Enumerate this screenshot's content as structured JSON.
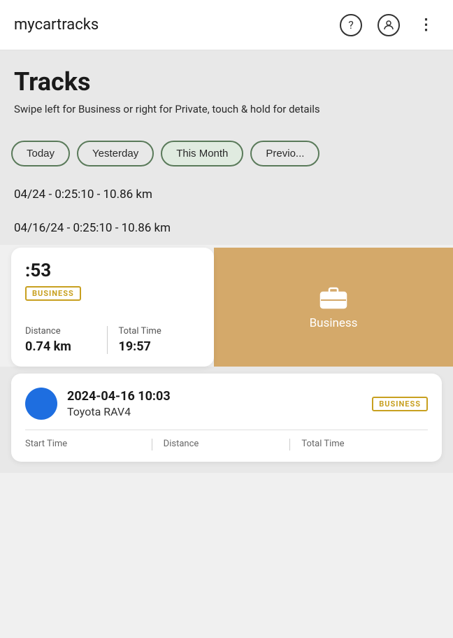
{
  "app": {
    "title": "mycartracks"
  },
  "header": {
    "tracks_title": "Tracks",
    "tracks_subtitle": "Swipe left for Business or right for Private, touch & hold for details"
  },
  "filter_tabs": [
    {
      "id": "today",
      "label": "Today"
    },
    {
      "id": "yesterday",
      "label": "Yesterday"
    },
    {
      "id": "this_month",
      "label": "This Month"
    },
    {
      "id": "previous",
      "label": "Previo..."
    }
  ],
  "track_rows": [
    {
      "text": "04/24 - 0:25:10 - 10.86 km"
    },
    {
      "text": "04/16/24 - 0:25:10 - 10.86 km"
    }
  ],
  "swipe_card": {
    "time": ":53",
    "badge": "BUSINESS",
    "distance_label": "Distance",
    "distance_value": "0.74 km",
    "total_time_label": "Total Time",
    "total_time_value": "19:57"
  },
  "business_panel": {
    "label": "Business",
    "icon": "briefcase"
  },
  "second_card": {
    "datetime": "2024-04-16 10:03",
    "vehicle": "Toyota RAV4",
    "badge": "BUSINESS",
    "start_time_label": "Start Time",
    "distance_label": "Distance",
    "total_time_label": "Total Time"
  },
  "icons": {
    "help": "?",
    "account": "👤",
    "more": "⋮"
  }
}
